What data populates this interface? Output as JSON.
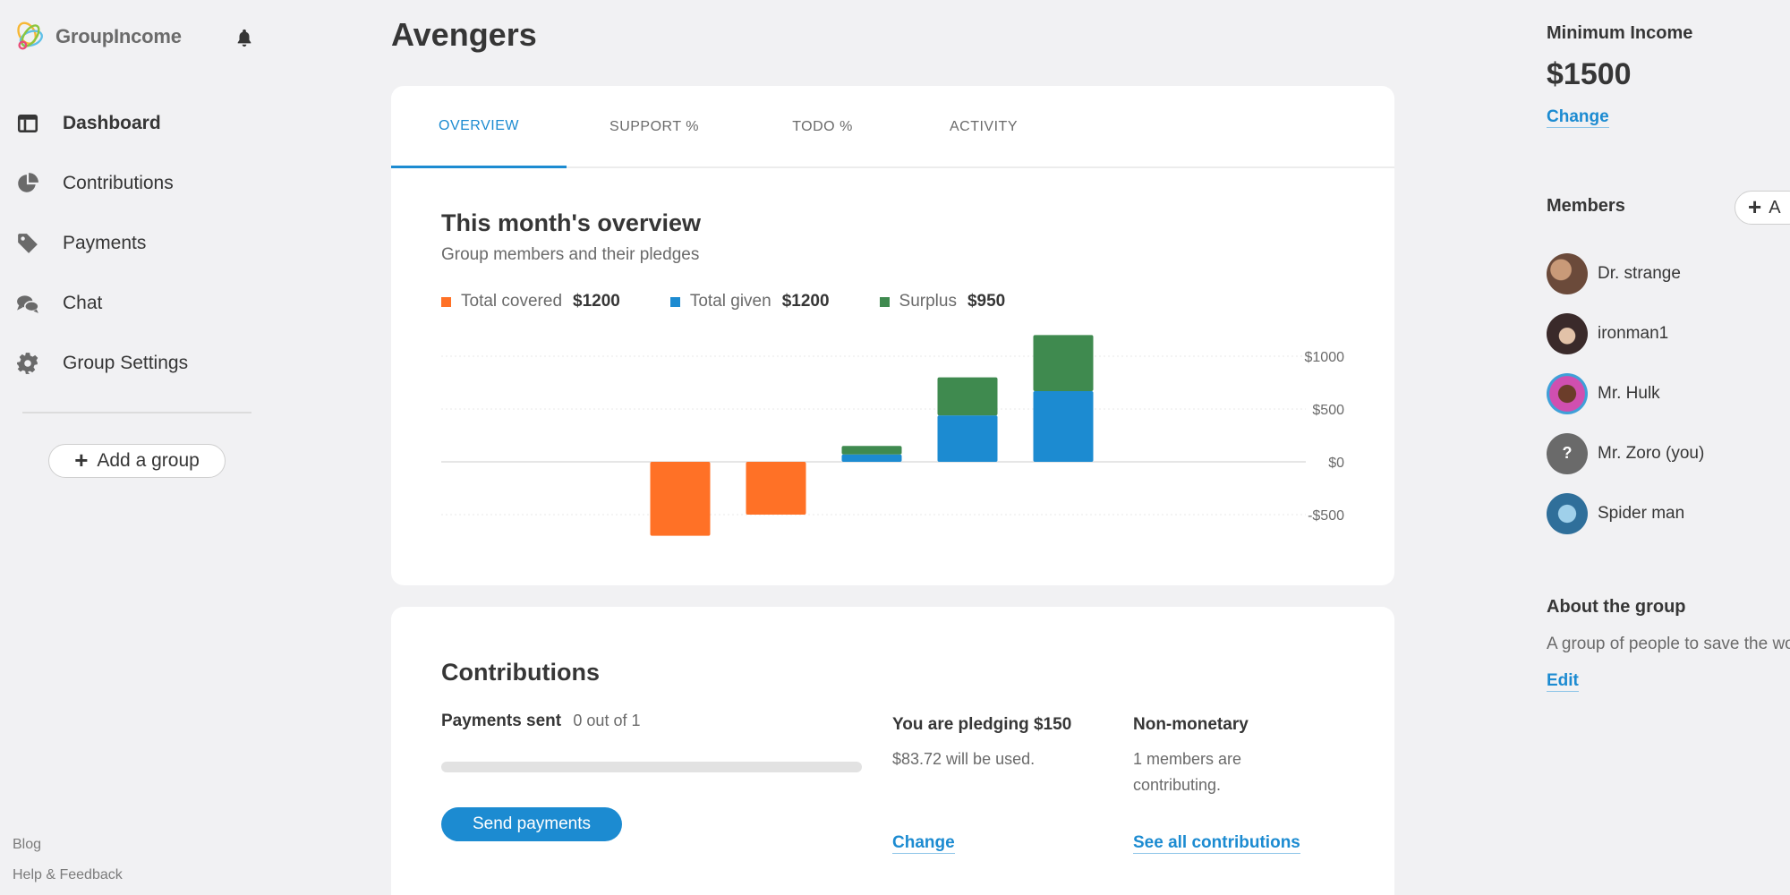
{
  "sidebar": {
    "logo_text": "GroupIncome",
    "nav": [
      {
        "label": "Dashboard",
        "icon": "dashboard-icon",
        "active": true
      },
      {
        "label": "Contributions",
        "icon": "pie-chart-icon"
      },
      {
        "label": "Payments",
        "icon": "tag-icon"
      },
      {
        "label": "Chat",
        "icon": "chat-icon"
      },
      {
        "label": "Group Settings",
        "icon": "gear-icon"
      }
    ],
    "add_group_label": "Add a group",
    "footer": {
      "blog": "Blog",
      "help": "Help & Feedback"
    }
  },
  "main": {
    "title": "Avengers",
    "tabs": [
      "OVERVIEW",
      "SUPPORT %",
      "TODO %",
      "ACTIVITY"
    ],
    "active_tab": "OVERVIEW",
    "overview": {
      "title": "This month's overview",
      "subtitle": "Group members and their pledges",
      "legend": [
        {
          "label": "Total covered",
          "value": "$1200",
          "color": "#ff7126"
        },
        {
          "label": "Total given",
          "value": "$1200",
          "color": "#1c8bd1"
        },
        {
          "label": "Surplus",
          "value": "$950",
          "color": "#3f8a4f"
        }
      ]
    },
    "contributions": {
      "title": "Contributions",
      "payments_sent_label": "Payments sent",
      "payments_sent_count": "0 out of 1",
      "payments_progress": 0,
      "send_button": "Send payments",
      "pledging_heading": "You are pledging $150",
      "pledging_text": "$83.72 will be used.",
      "pledging_link": "Change",
      "nonmonetary_heading": "Non-monetary",
      "nonmonetary_text": "1 members are contributing.",
      "nonmonetary_link": "See all contributions"
    }
  },
  "right": {
    "min_income_label": "Minimum Income",
    "min_income_value": "$1500",
    "min_income_change": "Change",
    "members_label": "Members",
    "add_member_label": "A",
    "members": [
      {
        "name": "Dr. strange",
        "avatar_color": "#8a6b55"
      },
      {
        "name": "ironman1",
        "avatar_color": "#5a3a3a"
      },
      {
        "name": "Mr. Hulk",
        "avatar_color": "#d04fb0"
      },
      {
        "name": "Mr. Zoro (you)",
        "avatar_color": "#6a6a6a",
        "initial": "?"
      },
      {
        "name": "Spider man",
        "avatar_color": "#2f80b0"
      }
    ],
    "about_label": "About the group",
    "about_text": "A group of people to save the wo",
    "about_edit": "Edit"
  },
  "chart_data": {
    "type": "bar",
    "stacked": true,
    "title": "",
    "ytick_labels": [
      "$1000",
      "$500",
      "$0",
      "-$500"
    ],
    "yticks": [
      1000,
      500,
      0,
      -500
    ],
    "ylim": [
      -700,
      1200
    ],
    "grid": true,
    "series": [
      {
        "name": "Total covered",
        "color": "#ff7126",
        "values": [
          0,
          0,
          -700,
          -500,
          0,
          0,
          0,
          0,
          0
        ]
      },
      {
        "name": "Total given",
        "color": "#1c8bd1",
        "values": [
          0,
          0,
          0,
          0,
          70,
          440,
          670,
          0,
          0
        ]
      },
      {
        "name": "Surplus",
        "color": "#3f8a4f",
        "values": [
          0,
          0,
          0,
          0,
          80,
          360,
          530,
          0,
          0
        ]
      }
    ]
  }
}
